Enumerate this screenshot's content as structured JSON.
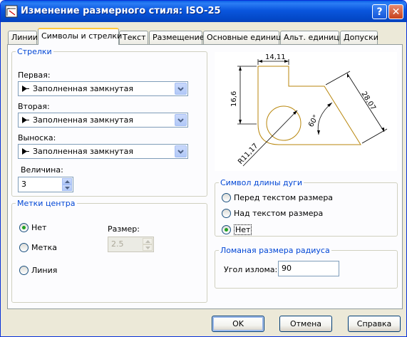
{
  "window": {
    "title": "Изменение размерного стиля: ISO-25",
    "help_label": "?",
    "close_label": "✕"
  },
  "tabs": [
    {
      "label": "Линии",
      "active": false
    },
    {
      "label": "Символы и стрелки",
      "active": true
    },
    {
      "label": "Текст",
      "active": false
    },
    {
      "label": "Размещение",
      "active": false
    },
    {
      "label": "Основные единицы",
      "active": false
    },
    {
      "label": "Альт. единицы",
      "active": false
    },
    {
      "label": "Допуски",
      "active": false
    }
  ],
  "arrows": {
    "legend": "Стрелки",
    "first_label": "Первая:",
    "first_value": "Заполненная замкнутая",
    "second_label": "Вторая:",
    "second_value": "Заполненная замкнутая",
    "leader_label": "Выноска:",
    "leader_value": "Заполненная замкнутая",
    "size_label": "Величина:",
    "size_value": "3"
  },
  "center_marks": {
    "legend": "Метки центра",
    "options": [
      "Нет",
      "Метка",
      "Линия"
    ],
    "selected": "Нет",
    "size_label": "Размер:",
    "size_value": "2.5"
  },
  "preview": {
    "dim_top": "14,11",
    "dim_left": "16,6",
    "dim_diag": "28,07",
    "dim_angle": "60°",
    "dim_radius": "R11,17"
  },
  "arc_symbol": {
    "legend": "Символ длины дуги",
    "options": [
      "Перед текстом размера",
      "Над текстом размера",
      "Нет"
    ],
    "selected": "Нет"
  },
  "jog": {
    "legend": "Ломаная размера радиуса",
    "angle_label": "Угол излома:",
    "angle_value": "90"
  },
  "buttons": {
    "ok": "OK",
    "cancel": "Отмена",
    "help": "Справка"
  },
  "colors": {
    "titlebar": "#0a56de",
    "group_legend": "#0046d5",
    "preview_geometry": "#b8860b"
  }
}
